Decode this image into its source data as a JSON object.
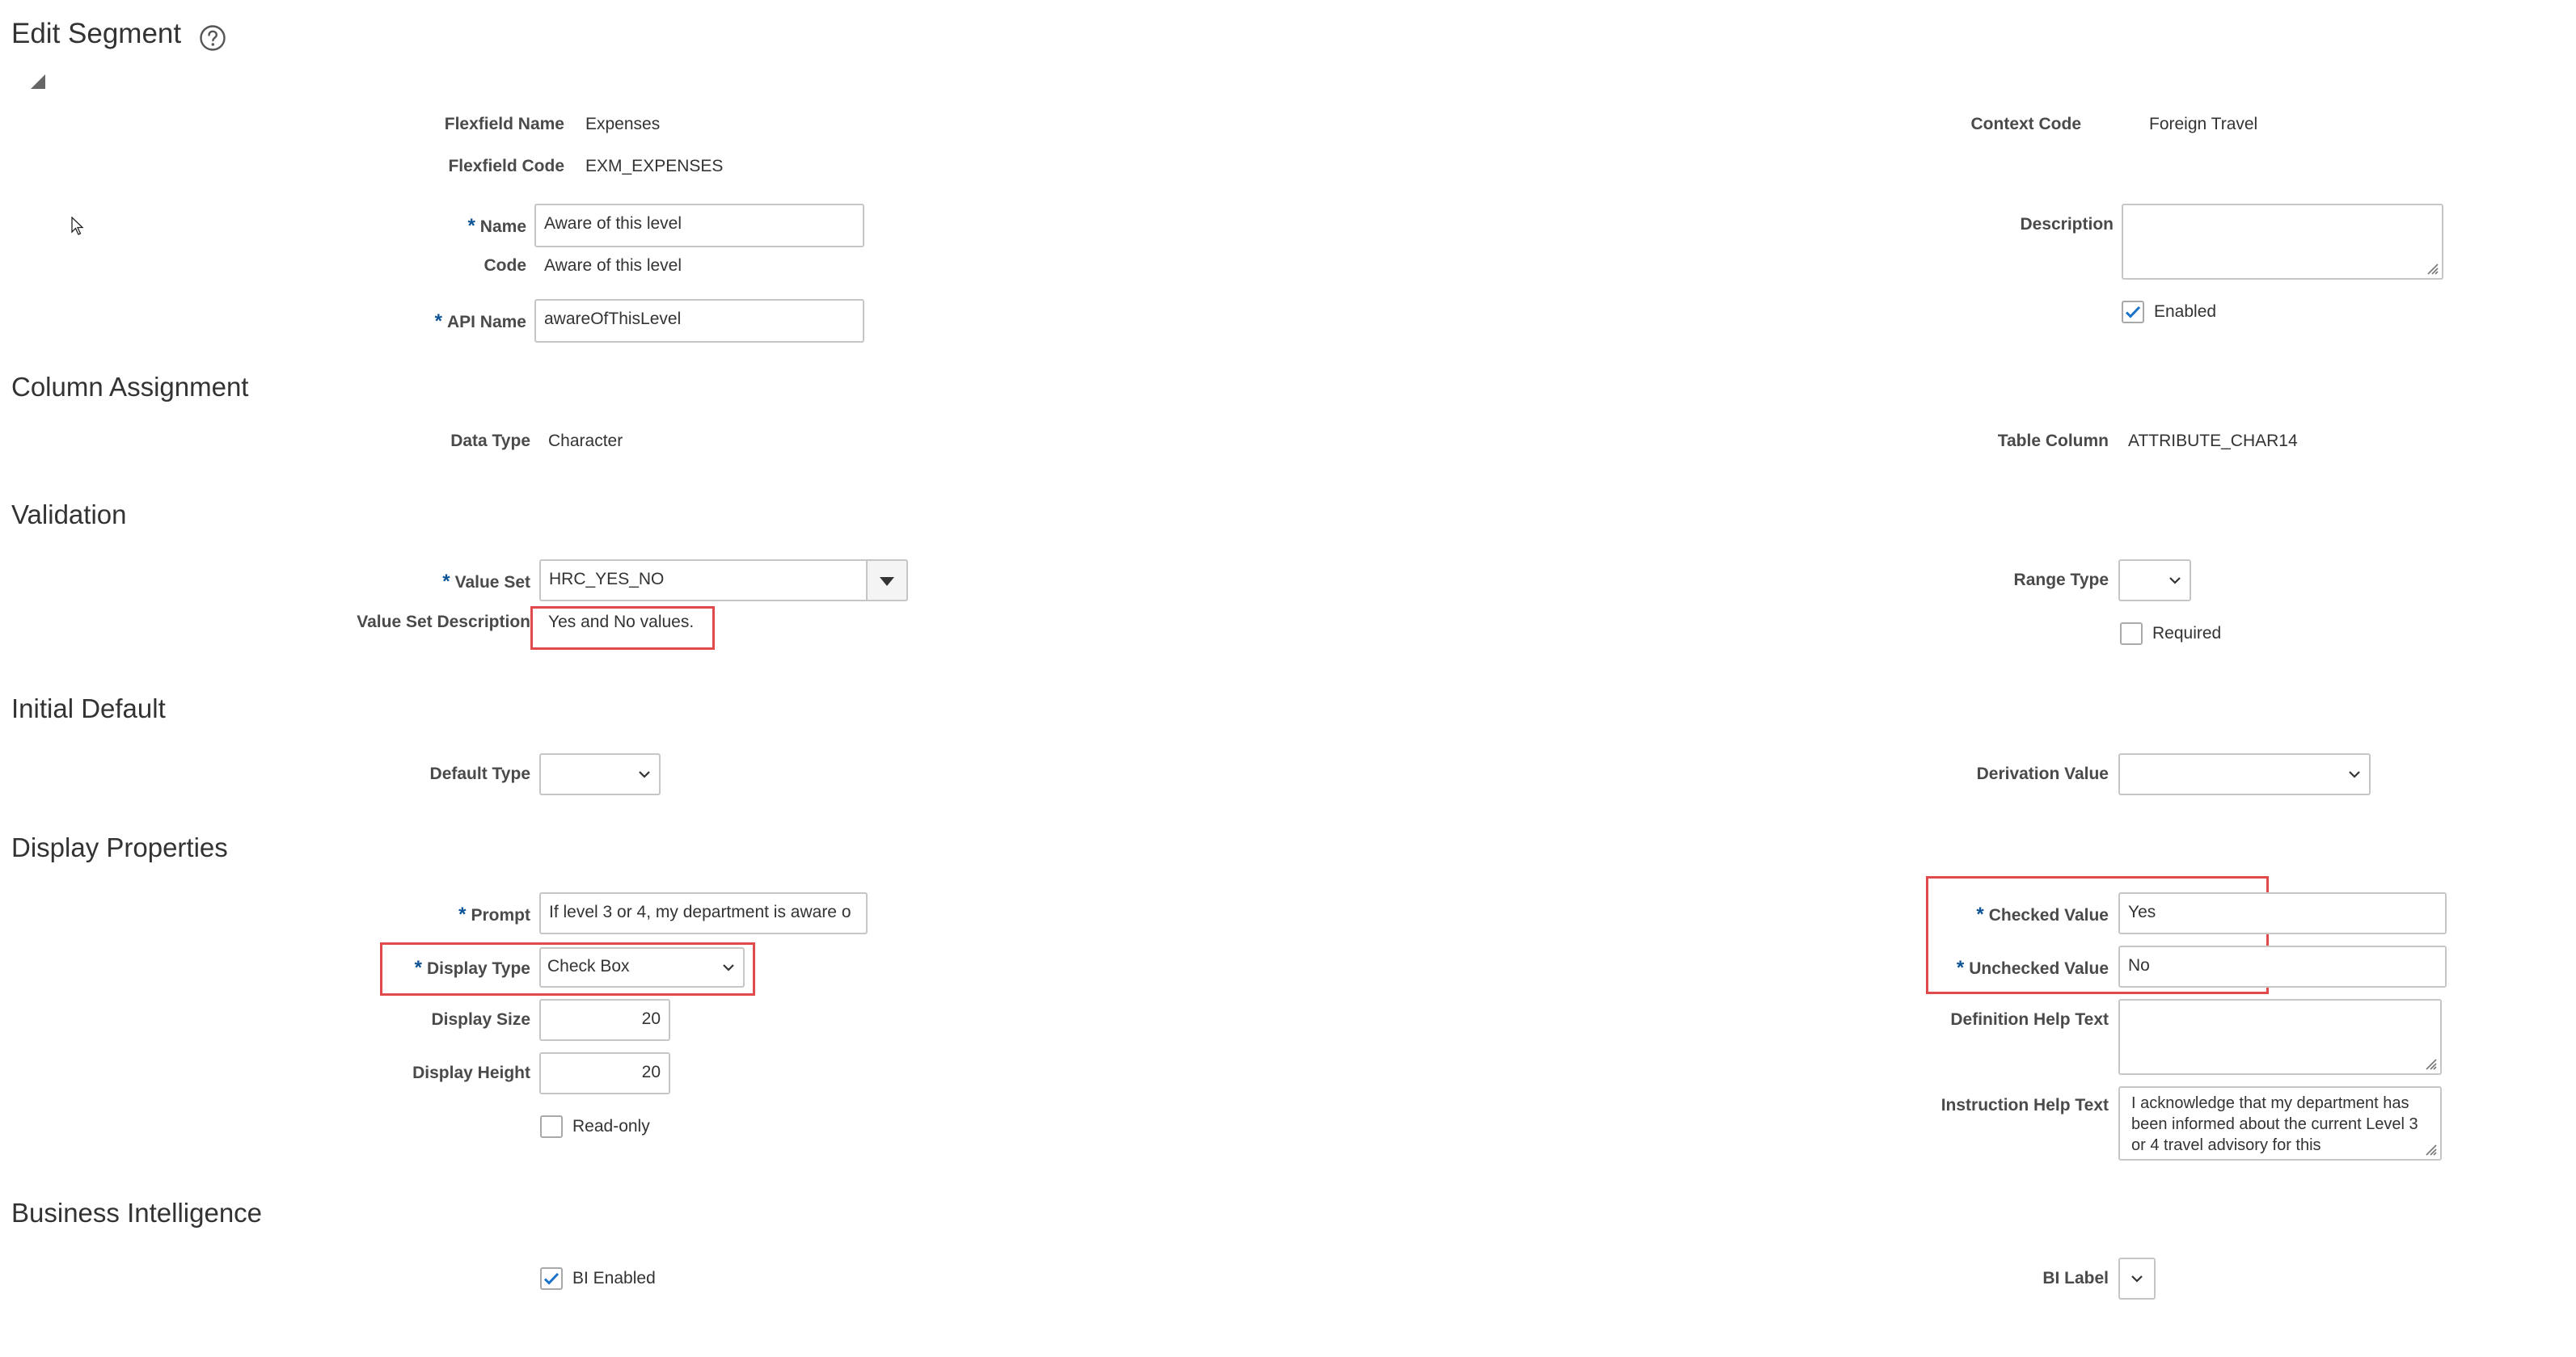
{
  "header": {
    "title": "Edit Segment",
    "help_icon": "question-circle-icon"
  },
  "general": {
    "flexfield_name_label": "Flexfield Name",
    "flexfield_name": "Expenses",
    "context_code_label": "Context Code",
    "context_code": "Foreign Travel",
    "flexfield_code_label": "Flexfield Code",
    "flexfield_code": "EXM_EXPENSES",
    "name_label": "Name",
    "name_value": "Aware of this level",
    "description_label": "Description",
    "description_value": "",
    "code_label": "Code",
    "code_value": "Aware of this level",
    "enabled_label": "Enabled",
    "enabled_checked": true,
    "api_name_label": "API Name",
    "api_name_value": "awareOfThisLevel"
  },
  "column_assignment": {
    "heading": "Column Assignment",
    "data_type_label": "Data Type",
    "data_type": "Character",
    "table_column_label": "Table Column",
    "table_column": "ATTRIBUTE_CHAR14"
  },
  "validation": {
    "heading": "Validation",
    "value_set_label": "Value Set",
    "value_set": "HRC_YES_NO",
    "range_type_label": "Range Type",
    "range_type": "",
    "value_set_description_label": "Value Set Description",
    "value_set_description": "Yes and No values.",
    "required_label": "Required",
    "required_checked": false
  },
  "initial_default": {
    "heading": "Initial Default",
    "default_type_label": "Default Type",
    "default_type": "",
    "derivation_value_label": "Derivation Value",
    "derivation_value": ""
  },
  "display_properties": {
    "heading": "Display Properties",
    "prompt_label": "Prompt",
    "prompt_value": "If level 3 or 4, my department is aware o",
    "checked_value_label": "Checked Value",
    "checked_value": "Yes",
    "display_type_label": "Display Type",
    "display_type": "Check Box",
    "unchecked_value_label": "Unchecked Value",
    "unchecked_value": "No",
    "display_size_label": "Display Size",
    "display_size": "20",
    "definition_help_label": "Definition Help Text",
    "definition_help": "",
    "display_height_label": "Display Height",
    "display_height": "20",
    "instruction_help_label": "Instruction Help Text",
    "instruction_help": "I acknowledge that my department has been informed about the current Level 3 or 4 travel advisory for this",
    "read_only_label": "Read-only",
    "read_only_checked": false
  },
  "business_intelligence": {
    "heading": "Business Intelligence",
    "bi_enabled_label": "BI Enabled",
    "bi_enabled_checked": true,
    "bi_label_label": "BI Label",
    "bi_label": ""
  },
  "colors": {
    "highlight": "#e04a4a",
    "required_star": "#0b5394",
    "checkbox_check": "#1a73c9"
  }
}
